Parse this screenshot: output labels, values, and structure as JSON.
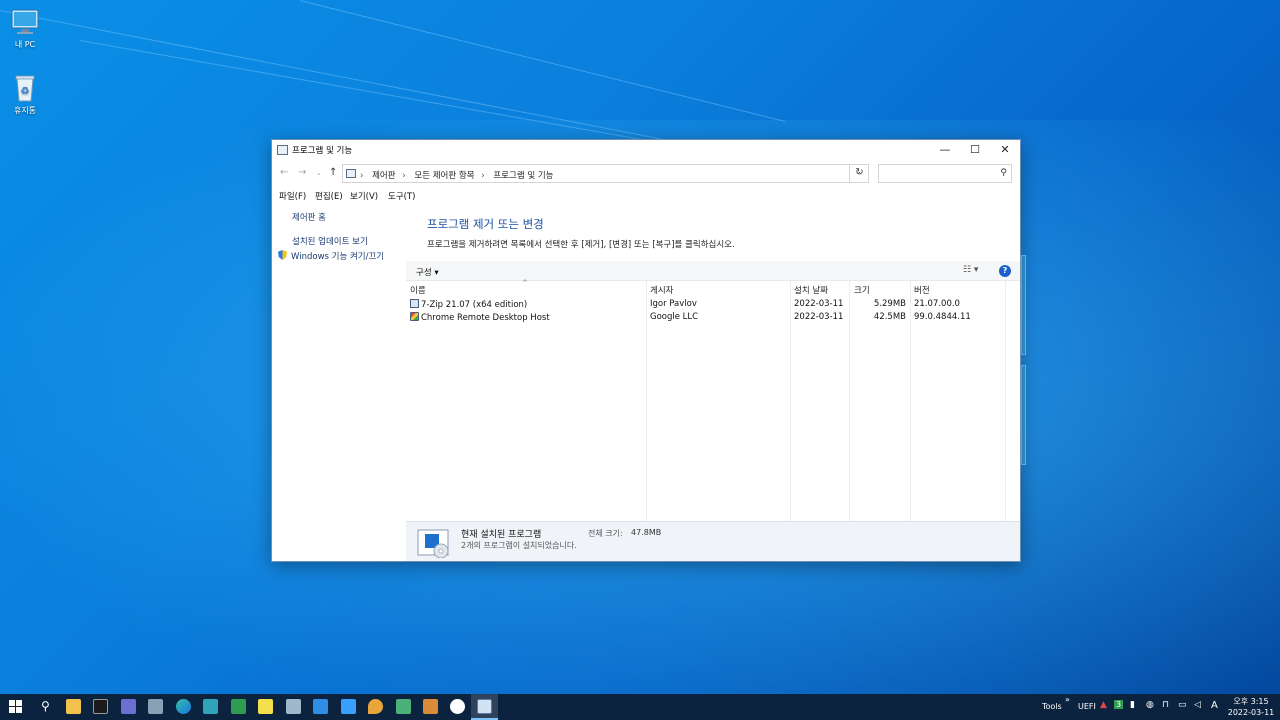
{
  "desktop": {
    "icons": [
      {
        "label": "내 PC"
      },
      {
        "label": "휴지통"
      }
    ]
  },
  "window": {
    "title": "프로그램 및 기능",
    "controls": {
      "minimize": "—",
      "maximize": "☐",
      "close": "✕"
    },
    "breadcrumbs": [
      "제어판",
      "모든 제어판 항목",
      "프로그램 및 기능"
    ],
    "search_placeholder": "",
    "menu": [
      "파일(F)",
      "편집(E)",
      "보기(V)",
      "도구(T)"
    ],
    "sidebar": {
      "home": "제어판 홈",
      "updates": "설치된 업데이트 보기",
      "features": "Windows 기능 켜기/끄기"
    },
    "heading": "프로그램 제거 또는 변경",
    "description": "프로그램을 제거하려면 목록에서 선택한 후 [제거], [변경] 또는 [복구]를 클릭하십시오.",
    "toolbar": {
      "organize": "구성 ▾",
      "view": "☷ ▾",
      "help": "?"
    },
    "columns": [
      "이름",
      "게시자",
      "설치 날짜",
      "크기",
      "버전"
    ],
    "programs": [
      {
        "name": "7-Zip 21.07 (x64 edition)",
        "publisher": "Igor Pavlov",
        "date": "2022-03-11",
        "size": "5.29MB",
        "version": "21.07.00.0"
      },
      {
        "name": "Chrome Remote Desktop Host",
        "publisher": "Google LLC",
        "date": "2022-03-11",
        "size": "42.5MB",
        "version": "99.0.4844.11"
      }
    ],
    "details": {
      "title": "현재 설치된 프로그램",
      "size_label": "전체 크기:",
      "size_value": "47.8MB",
      "count_text": "2개의 프로그램이 설치되었습니다."
    }
  },
  "taskbar": {
    "tray": {
      "tools": "Tools",
      "uefi": "UEFI",
      "ime": "A",
      "badge": "3"
    },
    "clock": {
      "time": "오후 3:15",
      "date": "2022-03-11"
    }
  }
}
